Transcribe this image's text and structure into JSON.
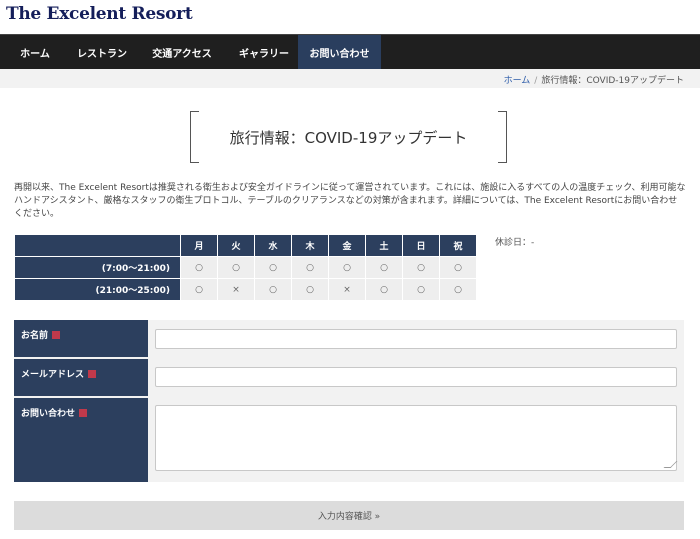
{
  "site": {
    "logo": "The Excelent Resort"
  },
  "nav": {
    "items": [
      {
        "label": "ホーム"
      },
      {
        "label": "レストラン"
      },
      {
        "label": "交通アクセス"
      },
      {
        "label": "ギャラリー"
      },
      {
        "label": "お問い合わせ",
        "active": true
      }
    ]
  },
  "breadcrumb": {
    "home": "ホーム",
    "separator": "/",
    "current": "旅行情報：COVID-19アップデート"
  },
  "page": {
    "title": "旅行情報：COVID-19アップデート",
    "intro": "再開以来、The Excelent Resortは推奨される衛生および安全ガイドラインに従って運営されています。これには、施設に入るすべての人の温度チェック、利用可能なハンドアシスタント、厳格なスタッフの衛生プロトコル、テーブルのクリアランスなどの対策が含まれます。詳細については、The Excelent Resortにお問い合わせください。"
  },
  "schedule": {
    "days": [
      "月",
      "火",
      "水",
      "木",
      "金",
      "土",
      "日",
      "祝"
    ],
    "rows": [
      {
        "time": "(7:00〜21:00)",
        "cells": [
          "○",
          "○",
          "○",
          "○",
          "○",
          "○",
          "○",
          "○"
        ]
      },
      {
        "time": "(21:00〜25:00)",
        "cells": [
          "○",
          "×",
          "○",
          "○",
          "×",
          "○",
          "○",
          "○"
        ]
      }
    ],
    "holiday": "休診日：-"
  },
  "form": {
    "name_label": "お名前",
    "email_label": "メールアドレス",
    "message_label": "お問い合わせ",
    "name_value": "",
    "email_value": "",
    "message_value": "",
    "submit_label": "入力内容確認 »"
  },
  "colors": {
    "nav_bg": "#1f1f1f",
    "nav_active": "#2a3e5e",
    "label_bg": "#2c3f5e",
    "required": "#c0394b",
    "logo": "#141e5a"
  }
}
